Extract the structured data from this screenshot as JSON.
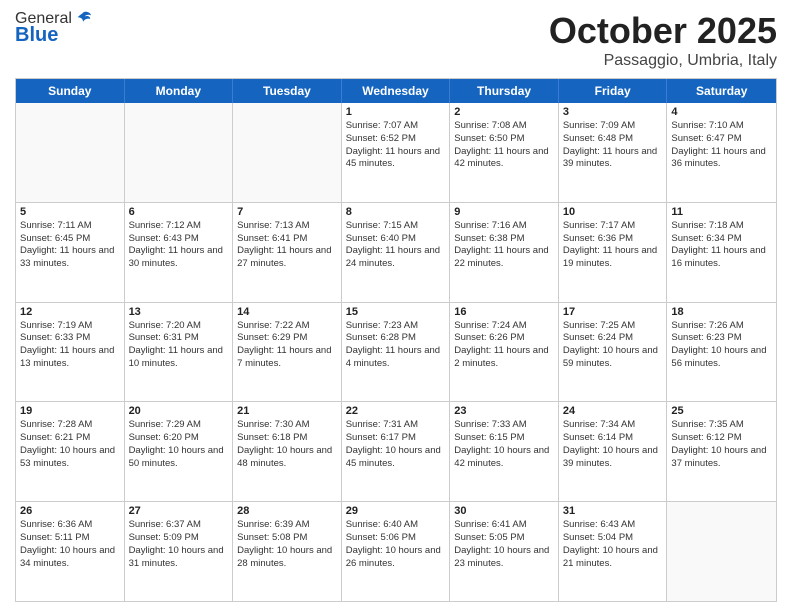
{
  "header": {
    "logo_general": "General",
    "logo_blue": "Blue",
    "month": "October 2025",
    "location": "Passaggio, Umbria, Italy"
  },
  "weekdays": [
    "Sunday",
    "Monday",
    "Tuesday",
    "Wednesday",
    "Thursday",
    "Friday",
    "Saturday"
  ],
  "rows": [
    [
      {
        "day": "",
        "text": ""
      },
      {
        "day": "",
        "text": ""
      },
      {
        "day": "",
        "text": ""
      },
      {
        "day": "1",
        "text": "Sunrise: 7:07 AM\nSunset: 6:52 PM\nDaylight: 11 hours and 45 minutes."
      },
      {
        "day": "2",
        "text": "Sunrise: 7:08 AM\nSunset: 6:50 PM\nDaylight: 11 hours and 42 minutes."
      },
      {
        "day": "3",
        "text": "Sunrise: 7:09 AM\nSunset: 6:48 PM\nDaylight: 11 hours and 39 minutes."
      },
      {
        "day": "4",
        "text": "Sunrise: 7:10 AM\nSunset: 6:47 PM\nDaylight: 11 hours and 36 minutes."
      }
    ],
    [
      {
        "day": "5",
        "text": "Sunrise: 7:11 AM\nSunset: 6:45 PM\nDaylight: 11 hours and 33 minutes."
      },
      {
        "day": "6",
        "text": "Sunrise: 7:12 AM\nSunset: 6:43 PM\nDaylight: 11 hours and 30 minutes."
      },
      {
        "day": "7",
        "text": "Sunrise: 7:13 AM\nSunset: 6:41 PM\nDaylight: 11 hours and 27 minutes."
      },
      {
        "day": "8",
        "text": "Sunrise: 7:15 AM\nSunset: 6:40 PM\nDaylight: 11 hours and 24 minutes."
      },
      {
        "day": "9",
        "text": "Sunrise: 7:16 AM\nSunset: 6:38 PM\nDaylight: 11 hours and 22 minutes."
      },
      {
        "day": "10",
        "text": "Sunrise: 7:17 AM\nSunset: 6:36 PM\nDaylight: 11 hours and 19 minutes."
      },
      {
        "day": "11",
        "text": "Sunrise: 7:18 AM\nSunset: 6:34 PM\nDaylight: 11 hours and 16 minutes."
      }
    ],
    [
      {
        "day": "12",
        "text": "Sunrise: 7:19 AM\nSunset: 6:33 PM\nDaylight: 11 hours and 13 minutes."
      },
      {
        "day": "13",
        "text": "Sunrise: 7:20 AM\nSunset: 6:31 PM\nDaylight: 11 hours and 10 minutes."
      },
      {
        "day": "14",
        "text": "Sunrise: 7:22 AM\nSunset: 6:29 PM\nDaylight: 11 hours and 7 minutes."
      },
      {
        "day": "15",
        "text": "Sunrise: 7:23 AM\nSunset: 6:28 PM\nDaylight: 11 hours and 4 minutes."
      },
      {
        "day": "16",
        "text": "Sunrise: 7:24 AM\nSunset: 6:26 PM\nDaylight: 11 hours and 2 minutes."
      },
      {
        "day": "17",
        "text": "Sunrise: 7:25 AM\nSunset: 6:24 PM\nDaylight: 10 hours and 59 minutes."
      },
      {
        "day": "18",
        "text": "Sunrise: 7:26 AM\nSunset: 6:23 PM\nDaylight: 10 hours and 56 minutes."
      }
    ],
    [
      {
        "day": "19",
        "text": "Sunrise: 7:28 AM\nSunset: 6:21 PM\nDaylight: 10 hours and 53 minutes."
      },
      {
        "day": "20",
        "text": "Sunrise: 7:29 AM\nSunset: 6:20 PM\nDaylight: 10 hours and 50 minutes."
      },
      {
        "day": "21",
        "text": "Sunrise: 7:30 AM\nSunset: 6:18 PM\nDaylight: 10 hours and 48 minutes."
      },
      {
        "day": "22",
        "text": "Sunrise: 7:31 AM\nSunset: 6:17 PM\nDaylight: 10 hours and 45 minutes."
      },
      {
        "day": "23",
        "text": "Sunrise: 7:33 AM\nSunset: 6:15 PM\nDaylight: 10 hours and 42 minutes."
      },
      {
        "day": "24",
        "text": "Sunrise: 7:34 AM\nSunset: 6:14 PM\nDaylight: 10 hours and 39 minutes."
      },
      {
        "day": "25",
        "text": "Sunrise: 7:35 AM\nSunset: 6:12 PM\nDaylight: 10 hours and 37 minutes."
      }
    ],
    [
      {
        "day": "26",
        "text": "Sunrise: 6:36 AM\nSunset: 5:11 PM\nDaylight: 10 hours and 34 minutes."
      },
      {
        "day": "27",
        "text": "Sunrise: 6:37 AM\nSunset: 5:09 PM\nDaylight: 10 hours and 31 minutes."
      },
      {
        "day": "28",
        "text": "Sunrise: 6:39 AM\nSunset: 5:08 PM\nDaylight: 10 hours and 28 minutes."
      },
      {
        "day": "29",
        "text": "Sunrise: 6:40 AM\nSunset: 5:06 PM\nDaylight: 10 hours and 26 minutes."
      },
      {
        "day": "30",
        "text": "Sunrise: 6:41 AM\nSunset: 5:05 PM\nDaylight: 10 hours and 23 minutes."
      },
      {
        "day": "31",
        "text": "Sunrise: 6:43 AM\nSunset: 5:04 PM\nDaylight: 10 hours and 21 minutes."
      },
      {
        "day": "",
        "text": ""
      }
    ]
  ]
}
